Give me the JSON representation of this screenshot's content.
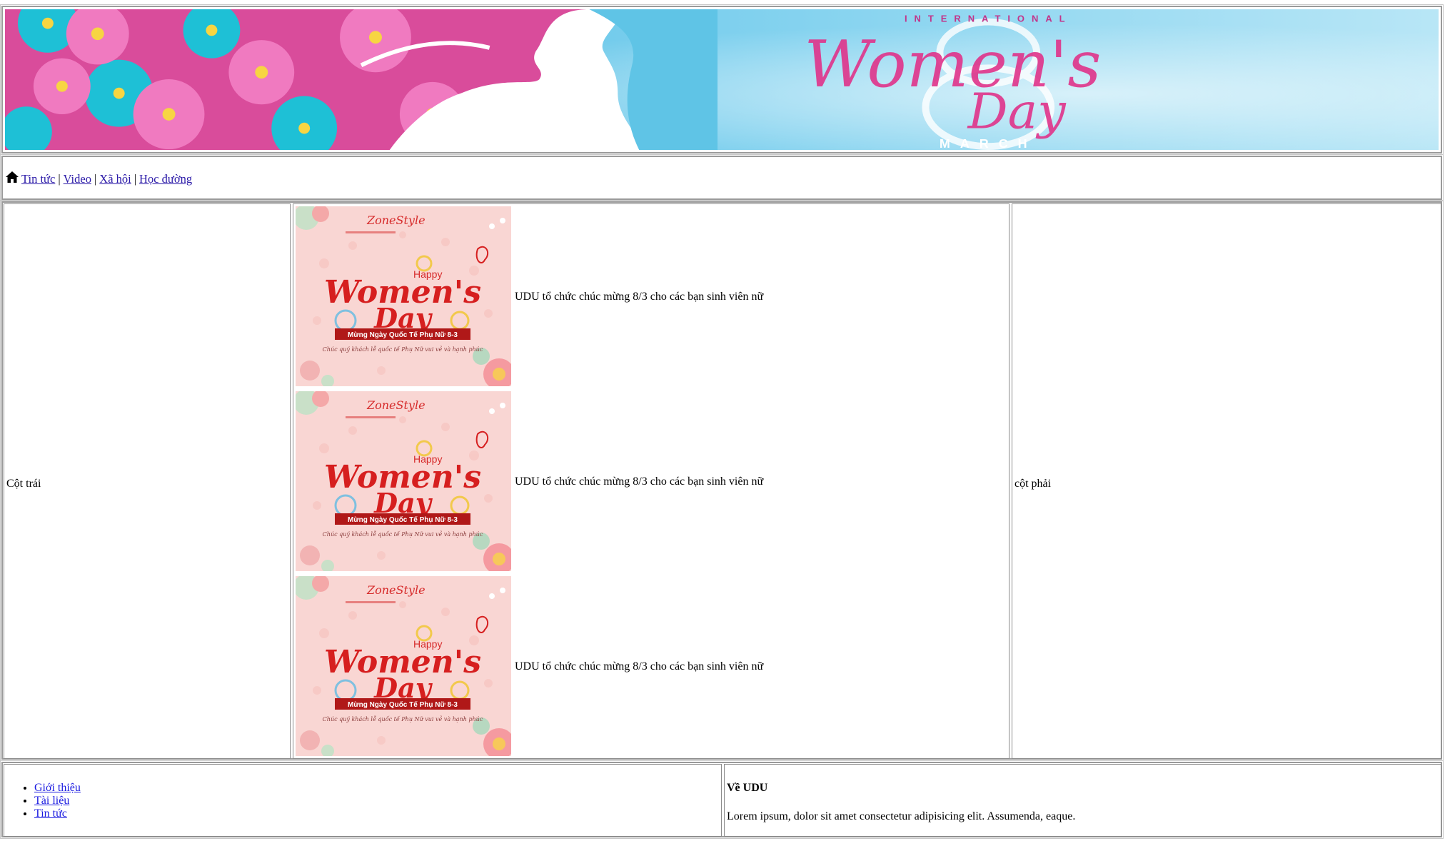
{
  "banner": {
    "heading_top": "INTERNATIONAL",
    "heading_main": "Women's",
    "heading_sub": "Day",
    "heading_bottom": "MARCH",
    "colors": {
      "sky": "#7dd3ef",
      "pink": "#e0338a",
      "teal": "#1ec0d6",
      "flower_pink": "#e85aa6"
    }
  },
  "nav": {
    "home_icon": "home-icon",
    "links": [
      "Tin tức",
      "Video",
      "Xã hội",
      "Học đường"
    ],
    "separator": "|"
  },
  "main": {
    "left_label": "Cột trái",
    "right_label": "cột phải",
    "news": [
      {
        "title": "UDU tổ chức chúc mừng 8/3 cho các bạn sinh viên nữ"
      },
      {
        "title": "UDU tổ chức chúc mừng 8/3 cho các bạn sinh viên nữ"
      },
      {
        "title": "UDU tổ chức chúc mừng 8/3 cho các bạn sinh viên nữ"
      }
    ],
    "thumb": {
      "brand": "ZoneStyle",
      "happy": "Happy",
      "womens": "Women's",
      "day": "Day",
      "ribbon": "Mừng Ngày Quốc Tế Phụ Nữ 8-3",
      "wish": "Chúc quý khách lễ quốc tế Phụ Nữ vui vẻ và hạnh phúc"
    }
  },
  "footer": {
    "links": [
      "Giới thiệu",
      "Tài liệu",
      "Tin tức"
    ],
    "about_title": "Về UDU",
    "about_text": "Lorem ipsum, dolor sit amet consectetur adipisicing elit. Assumenda, eaque."
  }
}
